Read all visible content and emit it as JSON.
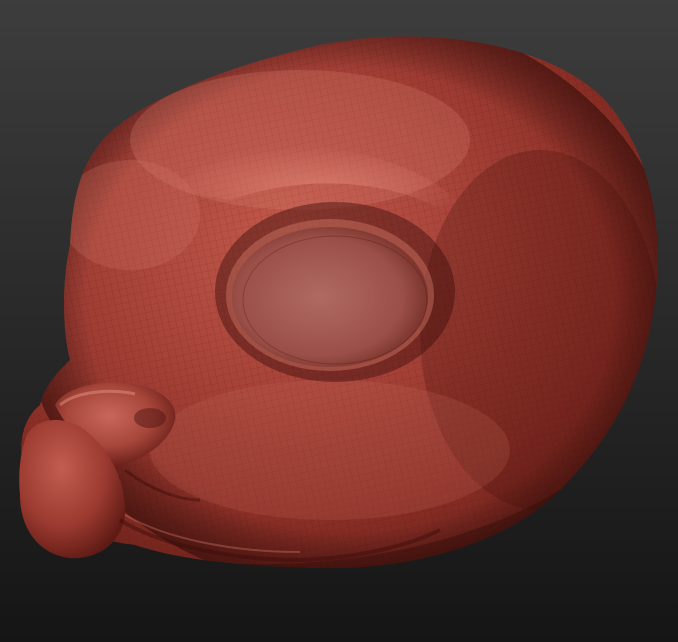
{
  "viewport": {
    "background_top": "#3d3d3d",
    "background_bottom": "#151515"
  },
  "model": {
    "material_base": "#8b2f26",
    "material_highlight": "#d97b6c",
    "material_shadow": "#4a140f",
    "wire_color": "#5a1a14"
  }
}
